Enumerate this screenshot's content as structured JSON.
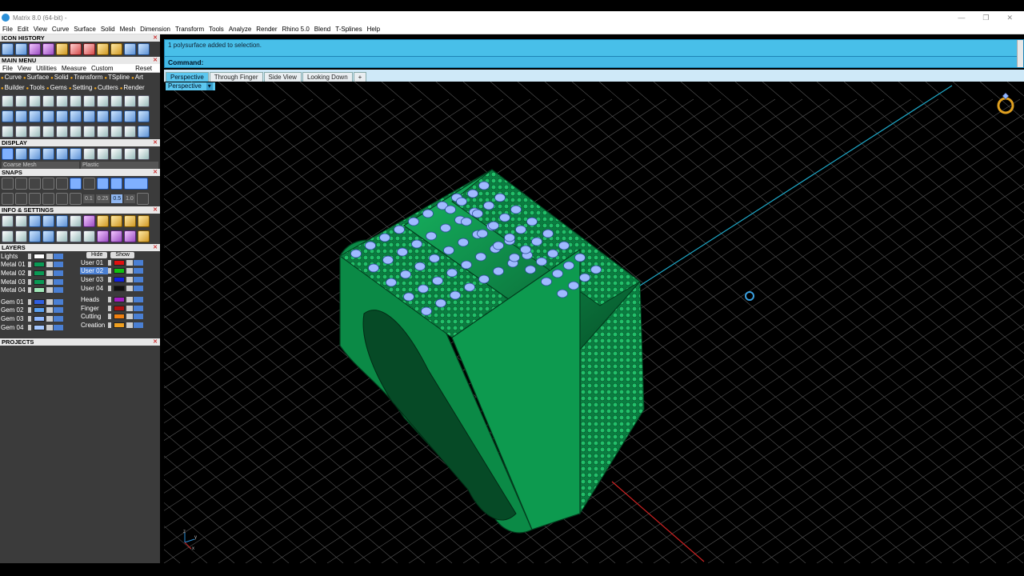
{
  "window": {
    "title": "Matrix 8.0 (64-bit) -",
    "controls": [
      "—",
      "❐",
      "✕"
    ]
  },
  "menu": [
    "File",
    "Edit",
    "View",
    "Curve",
    "Surface",
    "Solid",
    "Mesh",
    "Dimension",
    "Transform",
    "Tools",
    "Analyze",
    "Render",
    "Rhino 5.0",
    "Blend",
    "T-Splines",
    "Help"
  ],
  "panel": {
    "icon_history": "ICON HISTORY",
    "main_menu": "MAIN MENU",
    "main_menu_items": [
      "File",
      "View",
      "Utilities",
      "Measure",
      "Custom"
    ],
    "reset": "Reset",
    "chips_row1": [
      "Curve",
      "Surface",
      "Solid",
      "Transform",
      "TSpline",
      "Art"
    ],
    "chips_row2": [
      "Builder",
      "Tools",
      "Gems",
      "Setting",
      "Cutters",
      "Render"
    ],
    "display": "DISPLAY",
    "display_mesh": "Coarse Mesh",
    "display_material": "Plastic",
    "snaps": "SNAPS",
    "snap_values": [
      "0.1",
      "0.25",
      "0.5",
      "1.0"
    ],
    "info_settings": "INFO & SETTINGS",
    "layers": "LAYERS",
    "hide": "Hide",
    "show": "Show",
    "projects": "PROJECTS",
    "close_glyph": "✕"
  },
  "layers_left": [
    {
      "name": "Lights",
      "color": "#ffffff"
    },
    {
      "name": "Metal 01",
      "color": "#0a9a55"
    },
    {
      "name": "Metal 02",
      "color": "#0a9a55"
    },
    {
      "name": "Metal 03",
      "color": "#0a9a55"
    },
    {
      "name": "Metal 04",
      "color": "#9fe6b8"
    },
    {
      "name": "Gem 01",
      "color": "#2f5fe0"
    },
    {
      "name": "Gem 02",
      "color": "#5aa0f0"
    },
    {
      "name": "Gem 03",
      "color": "#8fb8ff"
    },
    {
      "name": "Gem 04",
      "color": "#a5c8ff"
    }
  ],
  "layers_right": [
    {
      "name": "User 01",
      "color": "#e01010"
    },
    {
      "name": "User 02",
      "color": "#10c010",
      "highlight": true
    },
    {
      "name": "User 03",
      "color": "#1020e0"
    },
    {
      "name": "User 04",
      "color": "#101010"
    },
    {
      "name": "Heads",
      "color": "#a020c0"
    },
    {
      "name": "Finger",
      "color": "#b01010"
    },
    {
      "name": "Cutting",
      "color": "#f08010"
    },
    {
      "name": "Creation",
      "color": "#f0a020"
    }
  ],
  "command": {
    "history": "1 polysurface added to selection.",
    "prompt": "Command:"
  },
  "tabs": [
    "Perspective",
    "Through Finger",
    "Side View",
    "Looking Down"
  ],
  "tab_add": "+",
  "viewport": {
    "label": "Perspective",
    "dropdown": "▾",
    "axis_z": "z",
    "axis_y": "y",
    "axis_x": "x"
  },
  "colors": {
    "ring": "#0d9a4f",
    "ring_dark": "#06532a",
    "gem": "#9fbaff",
    "grid": "#5a5a5a",
    "accent": "#44b9e6"
  }
}
